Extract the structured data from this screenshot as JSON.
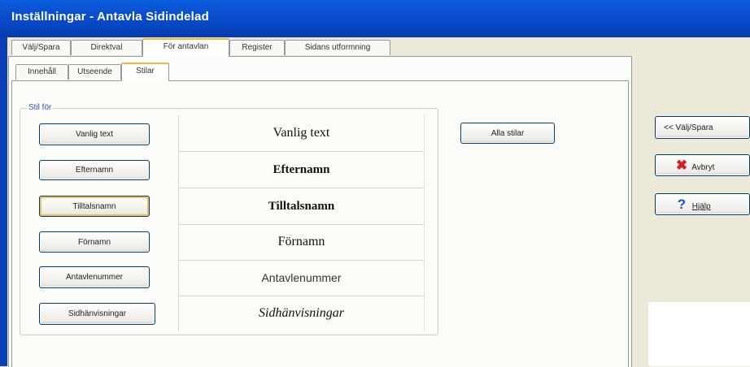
{
  "window": {
    "title": "Inställningar - Antavla  Sidindelad"
  },
  "tabs_top": [
    {
      "label": "Välj/Spara"
    },
    {
      "label": "Direktval"
    },
    {
      "label": "För antavlan"
    },
    {
      "label": "Register"
    },
    {
      "label": "Sidans utformning"
    }
  ],
  "tabs_sub": [
    {
      "label": "Innehåll"
    },
    {
      "label": "Utseende"
    },
    {
      "label": "Stilar"
    }
  ],
  "group": {
    "legend": "Stil för"
  },
  "style_buttons": [
    {
      "label": "Vanlig text"
    },
    {
      "label": "Efternamn"
    },
    {
      "label": "Tilltalsnamn"
    },
    {
      "label": "Förnamn"
    },
    {
      "label": "Antavlenummer"
    },
    {
      "label": "Sidhänvisningar"
    }
  ],
  "previews": [
    {
      "text": "Vanlig text",
      "style": "normal"
    },
    {
      "text": "Efternamn",
      "style": "bold"
    },
    {
      "text": "Tilltalsnamn",
      "style": "bold"
    },
    {
      "text": "Förnamn",
      "style": "normal"
    },
    {
      "text": "Antavlenummer",
      "style": "sans"
    },
    {
      "text": "Sidhänvisningar",
      "style": "italic"
    }
  ],
  "alla_stilar": {
    "label": "Alla stilar"
  },
  "right_buttons": {
    "back": {
      "label": "<< Välj/Spara"
    },
    "cancel": {
      "label": "Avbryt",
      "icon": "red-x-icon"
    },
    "help": {
      "label": "Hjälp",
      "icon": "help-question-icon"
    }
  },
  "colors": {
    "titlebar": "#0b4fd0",
    "tab_highlight": "#f3b73c",
    "legend_text": "#2d58c8",
    "cancel_icon": "#d42020",
    "help_icon": "#2050c8"
  }
}
